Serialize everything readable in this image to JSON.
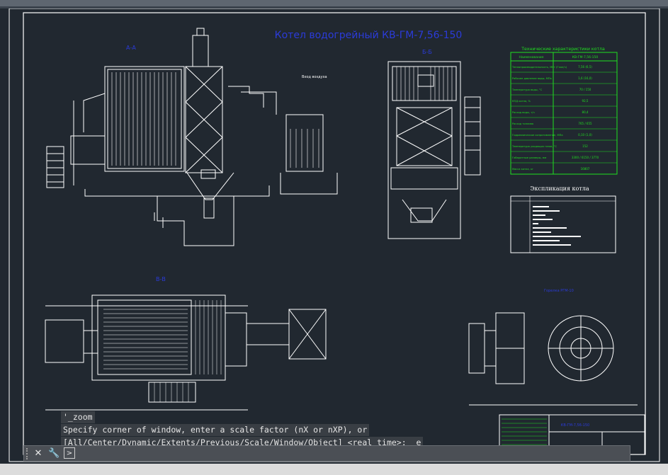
{
  "drawing": {
    "main_title": "Котел водогрейный КВ-ГМ-7,56-150",
    "section_aa": "А-А",
    "section_bb": "Б-Б",
    "section_vv": "В-В",
    "entry_label": "Вход воздуха",
    "tech_table": {
      "title": "Технические характеристики котла",
      "header_left": "Наименование",
      "header_right": "КВ-ГМ-7,56-150",
      "rows": [
        {
          "label": "Теплопроизводительность, МВт (Гкал/ч)",
          "value": "7,56 (6,5)"
        },
        {
          "label": "Рабочее давление воды, МПа",
          "value": "1,6 (16,0)"
        },
        {
          "label": "Температура воды, °С",
          "value": "70 / 150"
        },
        {
          "label": "КПД котла, %",
          "value": "92,5"
        },
        {
          "label": "Расход воды, т/ч",
          "value": "80,4"
        },
        {
          "label": "Расход топлива",
          "value": "765 / 655"
        },
        {
          "label": "Гидравлическое сопротивление, МПа",
          "value": "0,10 (1,0)"
        },
        {
          "label": "Температура уходящих газов, °С",
          "value": "152"
        },
        {
          "label": "Габаритные размеры, мм",
          "value": "3300 / 6150 / 3770"
        },
        {
          "label": "Масса котла, кг",
          "value": "16807"
        }
      ]
    },
    "explication_title": "Экспликация котла",
    "burner_label": "Горелка РГМ-10",
    "stamp_title": "КВ-ГМ-7,56-150"
  },
  "command_line": {
    "history": [
      "'_zoom",
      "Specify corner of window, enter a scale factor (nX or nXP), or",
      "[All/Center/Dynamic/Extents/Previous/Scale/Window/Object] <real time>: _e"
    ],
    "input_placeholder": "",
    "close_symbol": "✕",
    "settings_symbol": "🔧",
    "prompt_symbol": ">"
  },
  "colors": {
    "background": "#212830",
    "linework": "#ffffff",
    "title_blue": "#2b3bd9",
    "table_green": "#1fe01f",
    "cmd_bar": "#4b4f55"
  }
}
